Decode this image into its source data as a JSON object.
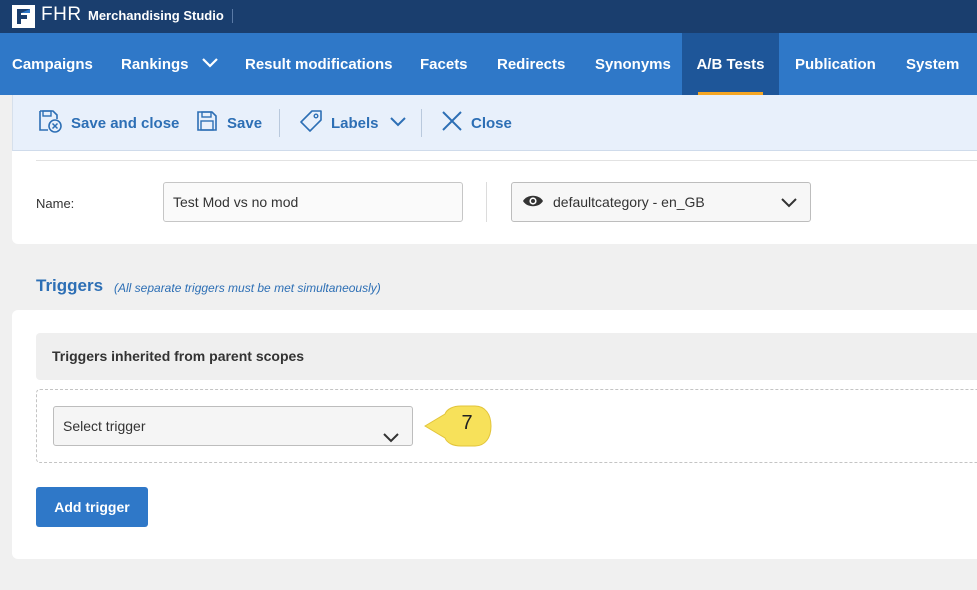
{
  "topbar": {
    "logo_text": "FHR",
    "product_name": "Merchandising Studio"
  },
  "nav": {
    "items": [
      {
        "label": "Campaigns"
      },
      {
        "label": "Rankings"
      },
      {
        "label": "Result modifications"
      },
      {
        "label": "Facets"
      },
      {
        "label": "Redirects"
      },
      {
        "label": "Synonyms"
      },
      {
        "label": "A/B Tests"
      },
      {
        "label": "Publication"
      },
      {
        "label": "System"
      }
    ],
    "active": "A/B Tests"
  },
  "toolbar": {
    "save_and_close_label": "Save and close",
    "save_label": "Save",
    "labels_label": "Labels",
    "close_label": "Close"
  },
  "form": {
    "name_label": "Name:",
    "name_value": "Test Mod vs no mod",
    "scope_value": "defaultcategory - en_GB"
  },
  "triggers": {
    "title": "Triggers",
    "note": "(All separate triggers must be met simultaneously)",
    "inherited_label": "Triggers inherited from parent scopes",
    "select_placeholder": "Select trigger",
    "callout_number": "7",
    "add_button_label": "Add trigger"
  },
  "colors": {
    "topbar": "#1a3e6e",
    "nav": "#2f78c8",
    "nav_active": "#1e5699",
    "accent_underline": "#f5a623",
    "link_blue": "#2d6fb5",
    "callout_yellow": "#f7e15a"
  },
  "icons": [
    "save-close-icon",
    "save-icon",
    "tag-icon",
    "chevron-down-icon",
    "close-icon",
    "eye-icon"
  ]
}
